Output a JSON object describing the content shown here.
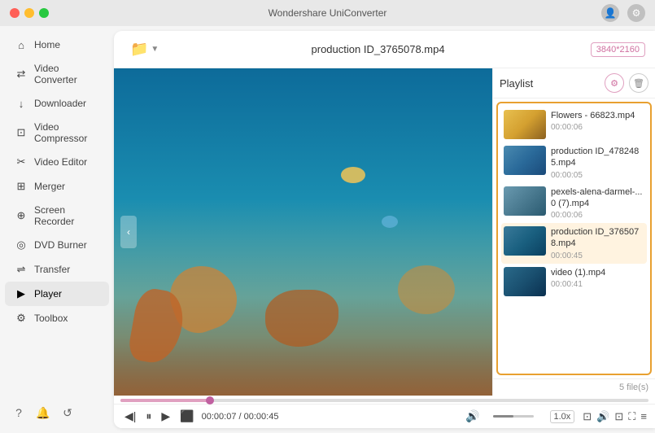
{
  "app": {
    "title": "Wondershare UniConverter"
  },
  "titlebar": {
    "title": "Wondershare UniConverter",
    "user_icon": "👤",
    "settings_icon": "⚙"
  },
  "sidebar": {
    "items": [
      {
        "id": "home",
        "label": "Home",
        "icon": "⌂"
      },
      {
        "id": "video-converter",
        "label": "Video Converter",
        "icon": "⇄"
      },
      {
        "id": "downloader",
        "label": "Downloader",
        "icon": "↓"
      },
      {
        "id": "video-compressor",
        "label": "Video Compressor",
        "icon": "⊡"
      },
      {
        "id": "video-editor",
        "label": "Video Editor",
        "icon": "✂"
      },
      {
        "id": "merger",
        "label": "Merger",
        "icon": "⊞"
      },
      {
        "id": "screen-recorder",
        "label": "Screen Recorder",
        "icon": "⊕"
      },
      {
        "id": "dvd-burner",
        "label": "DVD Burner",
        "icon": "◎"
      },
      {
        "id": "transfer",
        "label": "Transfer",
        "icon": "⇌"
      },
      {
        "id": "player",
        "label": "Player",
        "icon": "▶",
        "active": true
      },
      {
        "id": "toolbox",
        "label": "Toolbox",
        "icon": "⚙"
      }
    ],
    "bottom_icons": [
      "?",
      "🔔",
      "↺"
    ]
  },
  "topbar": {
    "current_file": "production ID_3765078.mp4",
    "resolution": "3840*2160"
  },
  "playlist": {
    "title": "Playlist",
    "items": [
      {
        "name": "Flowers - 66823.mp4",
        "duration": "00:00:06",
        "thumb_class": "thumb-flowers"
      },
      {
        "name": "production ID_4782485.mp4",
        "duration": "00:00:05",
        "thumb_class": "thumb-production"
      },
      {
        "name": "pexels-alena-darmel-...0 (7).mp4",
        "duration": "00:00:06",
        "thumb_class": "thumb-pexels"
      },
      {
        "name": "production ID_3765078.mp4",
        "duration": "00:00:45",
        "thumb_class": "thumb-production2",
        "active": true
      },
      {
        "name": "video (1).mp4",
        "duration": "00:00:41",
        "thumb_class": "thumb-video"
      }
    ],
    "file_count": "5 file(s)"
  },
  "controls": {
    "current_time": "00:00:07",
    "total_time": "00:00:45",
    "speed": "1.0x"
  }
}
